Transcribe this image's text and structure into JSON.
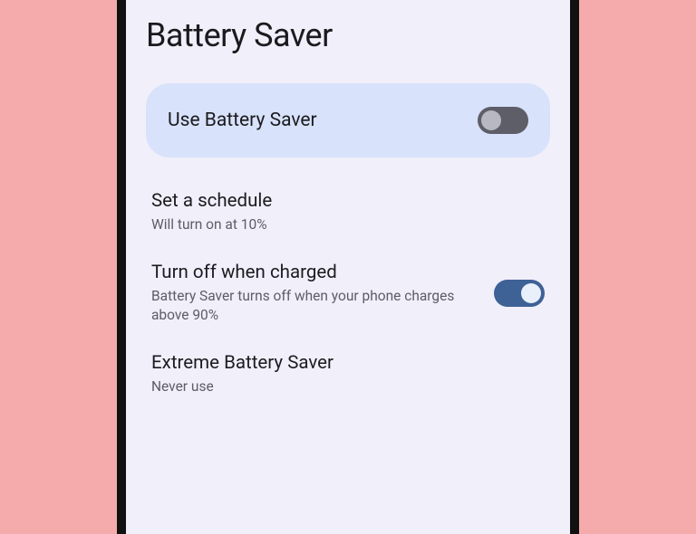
{
  "page": {
    "title": "Battery Saver"
  },
  "hero": {
    "label": "Use Battery Saver",
    "enabled": false
  },
  "settings": {
    "schedule": {
      "title": "Set a schedule",
      "subtitle": "Will turn on at 10%"
    },
    "turnOffCharged": {
      "title": "Turn off when charged",
      "subtitle": "Battery Saver turns off when your phone charges above 90%",
      "enabled": true
    },
    "extreme": {
      "title": "Extreme Battery Saver",
      "subtitle": "Never use"
    }
  }
}
